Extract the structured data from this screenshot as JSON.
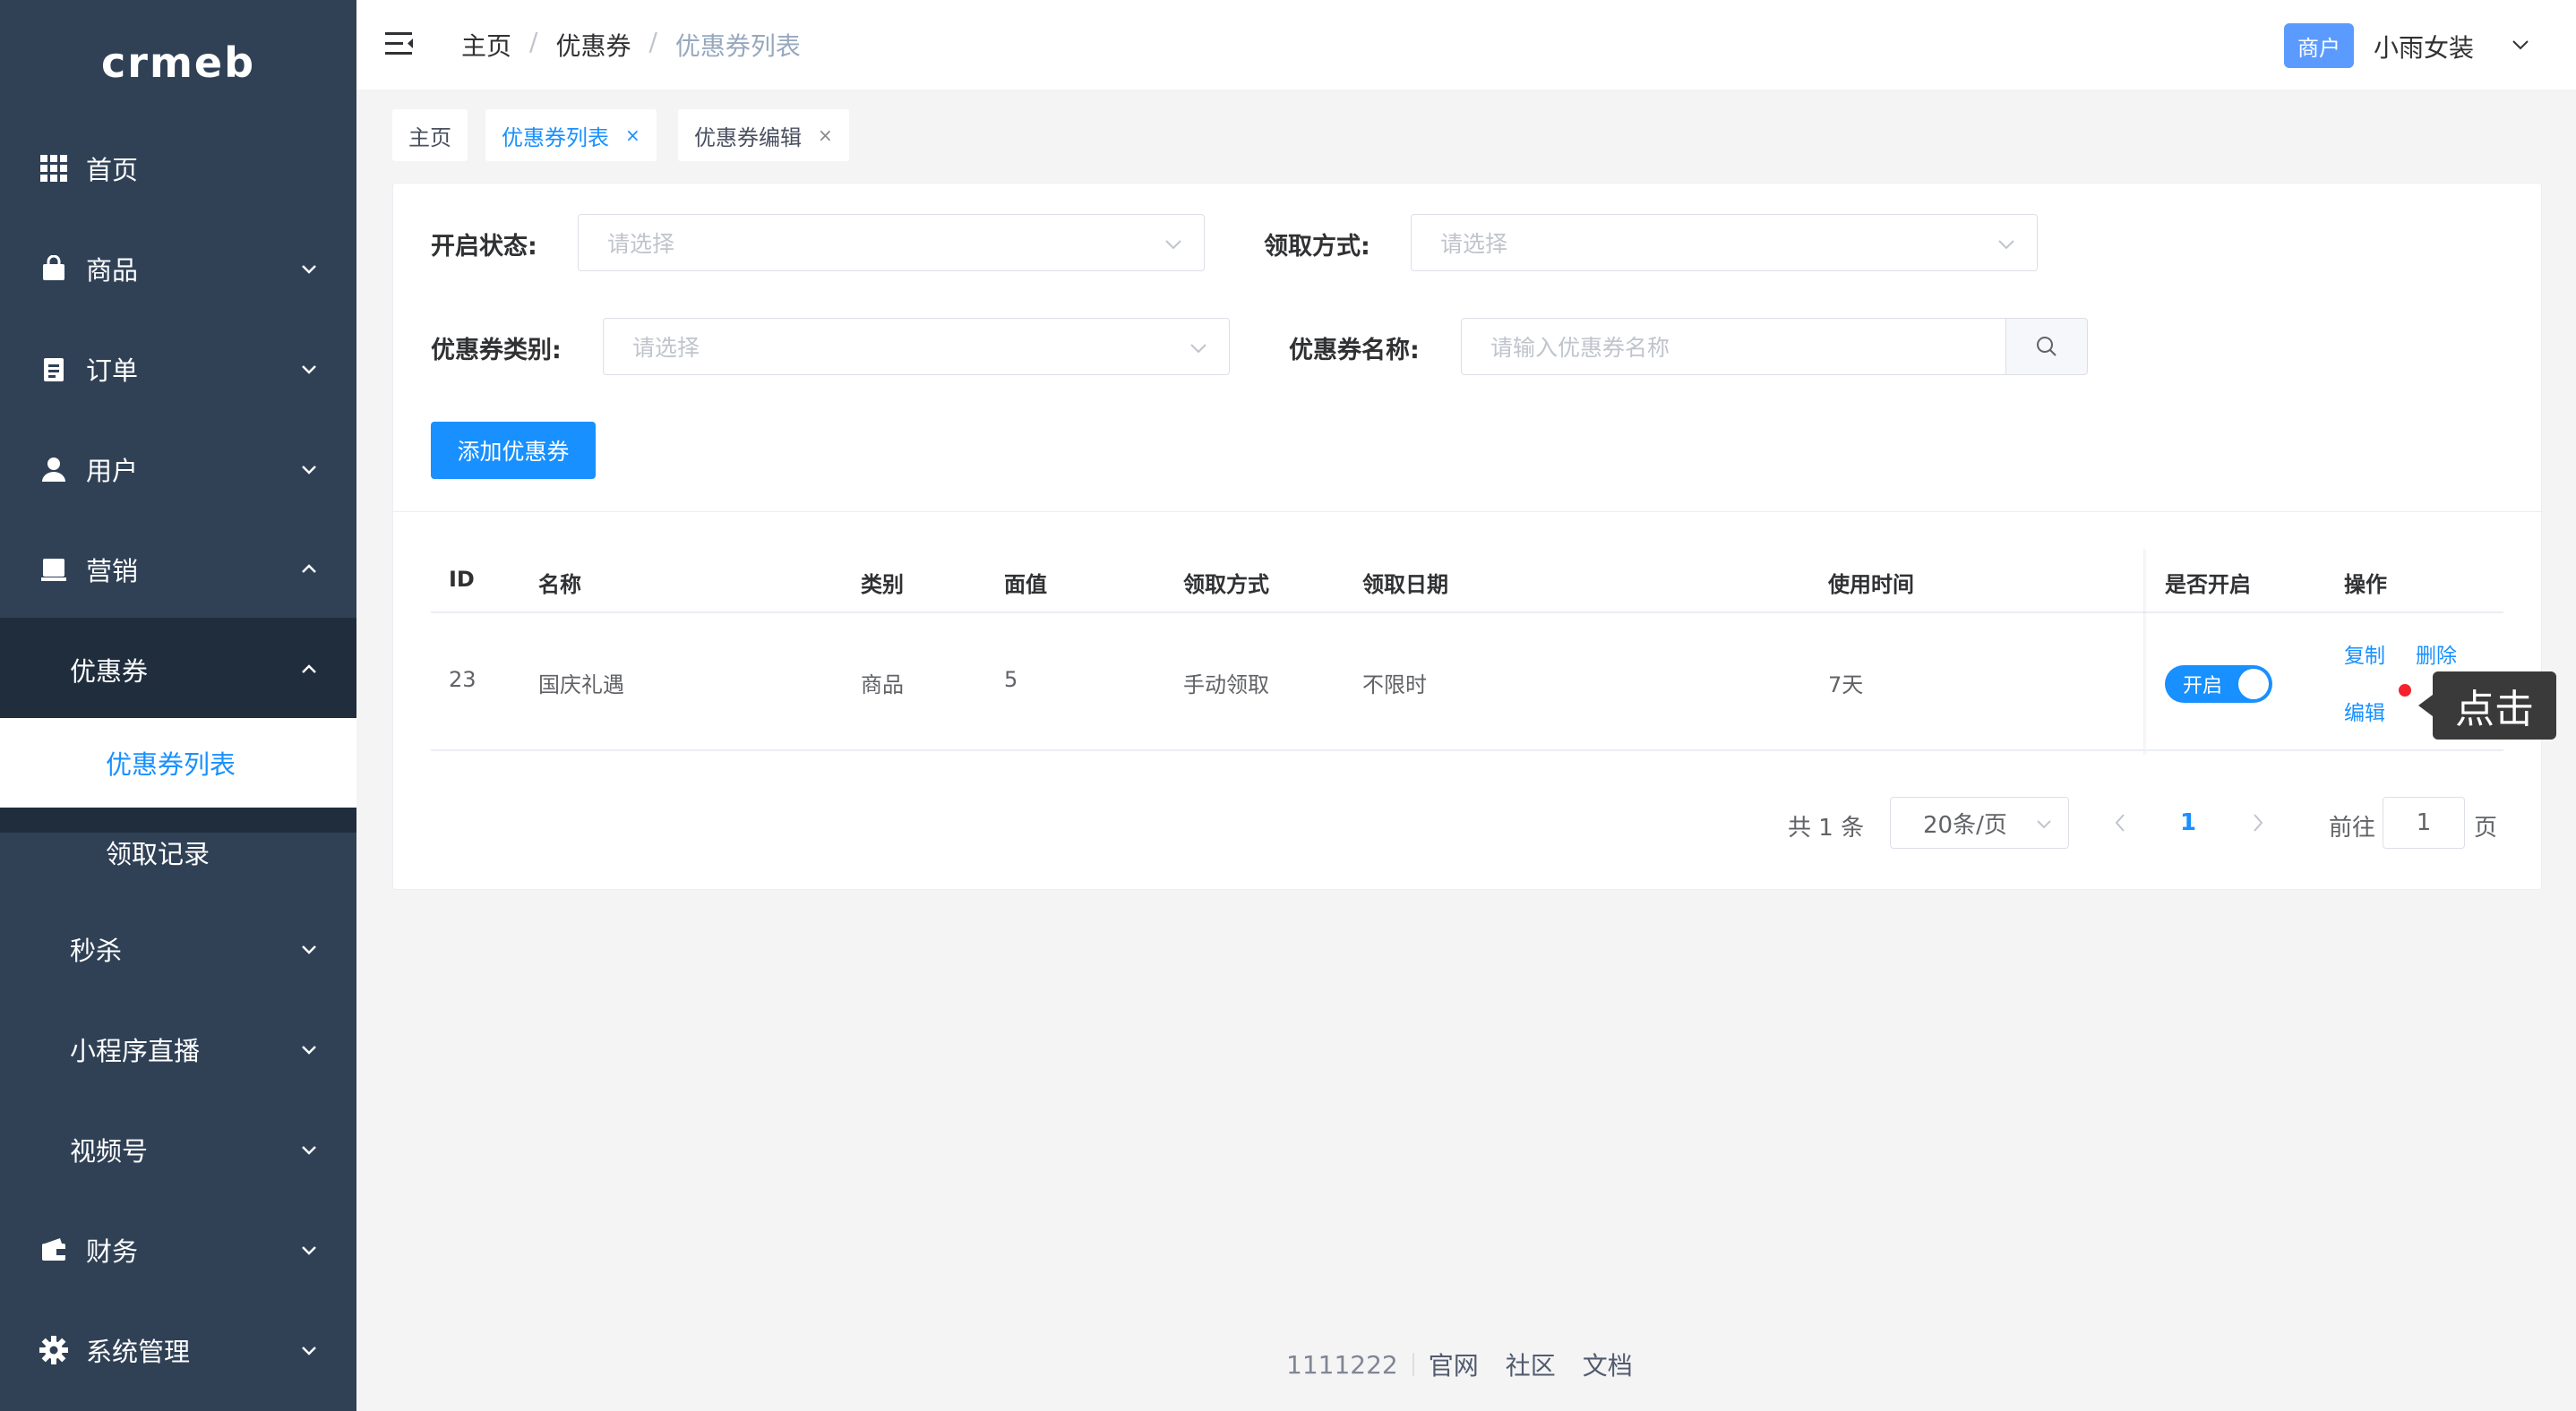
{
  "brand": {
    "logo_text": "crmeb"
  },
  "sidebar": {
    "items": [
      {
        "label": "首页",
        "icon": "grid-icon"
      },
      {
        "label": "商品",
        "icon": "shopping-bag-icon"
      },
      {
        "label": "订单",
        "icon": "clipboard-icon"
      },
      {
        "label": "用户",
        "icon": "user-icon"
      },
      {
        "label": "营销",
        "icon": "inbox-icon"
      },
      {
        "label": "优惠券"
      },
      {
        "label": "优惠券列表"
      },
      {
        "label": "领取记录"
      },
      {
        "label": "秒杀"
      },
      {
        "label": "小程序直播"
      },
      {
        "label": "视频号"
      },
      {
        "label": "财务",
        "icon": "wallet-icon"
      },
      {
        "label": "系统管理",
        "icon": "gear-icon"
      }
    ]
  },
  "header": {
    "breadcrumb": [
      "主页",
      "优惠券",
      "优惠券列表"
    ],
    "badge": "商户",
    "user_name": "小雨女装"
  },
  "tags": [
    {
      "label": "主页"
    },
    {
      "label": "优惠券列表"
    },
    {
      "label": "优惠券编辑"
    }
  ],
  "filters": {
    "status_label": "开启状态:",
    "status_placeholder": "请选择",
    "receive_label": "领取方式:",
    "receive_placeholder": "请选择",
    "category_label": "优惠券类别:",
    "category_placeholder": "请选择",
    "name_label": "优惠券名称:",
    "name_placeholder": "请输入优惠券名称",
    "add_button": "添加优惠券"
  },
  "table": {
    "columns": [
      "ID",
      "名称",
      "类别",
      "面值",
      "领取方式",
      "领取日期",
      "使用时间",
      "是否开启",
      "操作"
    ],
    "rows": [
      {
        "id": "23",
        "name": "国庆礼遇",
        "category": "商品",
        "value": "5",
        "receive_method": "手动领取",
        "receive_date": "不限时",
        "use_time": "7天",
        "enabled_label": "开启",
        "enabled": true,
        "actions": [
          "复制",
          "删除",
          "编辑"
        ]
      }
    ]
  },
  "pagination": {
    "total_text": "共 1 条",
    "page_size": "20条/页",
    "current_page": "1",
    "goto_label": "前往",
    "goto_value": "1",
    "page_suffix": "页"
  },
  "tooltip": {
    "text": "点击"
  },
  "footer": {
    "code": "1111222",
    "links": [
      "官网",
      "社区",
      "文档"
    ]
  },
  "colors": {
    "sidebar_bg": "#304156",
    "primary": "#1890ff",
    "badge": "#5b9bff"
  }
}
